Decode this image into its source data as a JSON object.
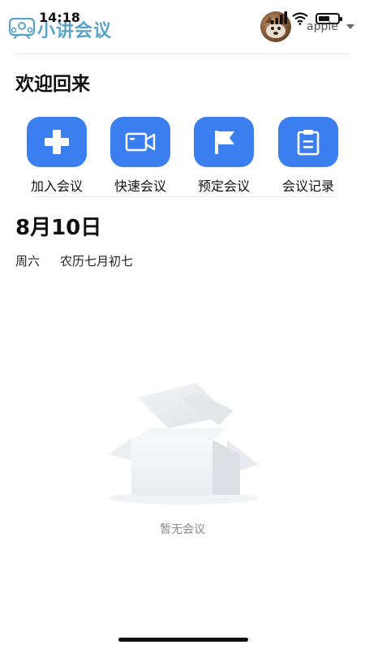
{
  "status_bar": {
    "time": "14:18",
    "battery_level": 0.6
  },
  "header": {
    "app_name": "小讲会议",
    "user_name": "apple",
    "logo_icon": "meeting-people-icon",
    "avatar_icon": "user-avatar-photo"
  },
  "welcome": {
    "title": "欢迎回来"
  },
  "actions": [
    {
      "label": "加入会议",
      "icon": "plus-icon"
    },
    {
      "label": "快速会议",
      "icon": "video-camera-icon"
    },
    {
      "label": "预定会议",
      "icon": "flag-icon"
    },
    {
      "label": "会议记录",
      "icon": "clipboard-icon"
    }
  ],
  "date": {
    "day": "8月10日",
    "weekday": "周六",
    "lunar": "农历七月初七"
  },
  "empty_state": {
    "text": "暂无会议",
    "icon": "empty-box-icon"
  },
  "colors": {
    "accent": "#3b7ef0",
    "logo": "#5aa3c8",
    "muted_text": "#888888"
  }
}
